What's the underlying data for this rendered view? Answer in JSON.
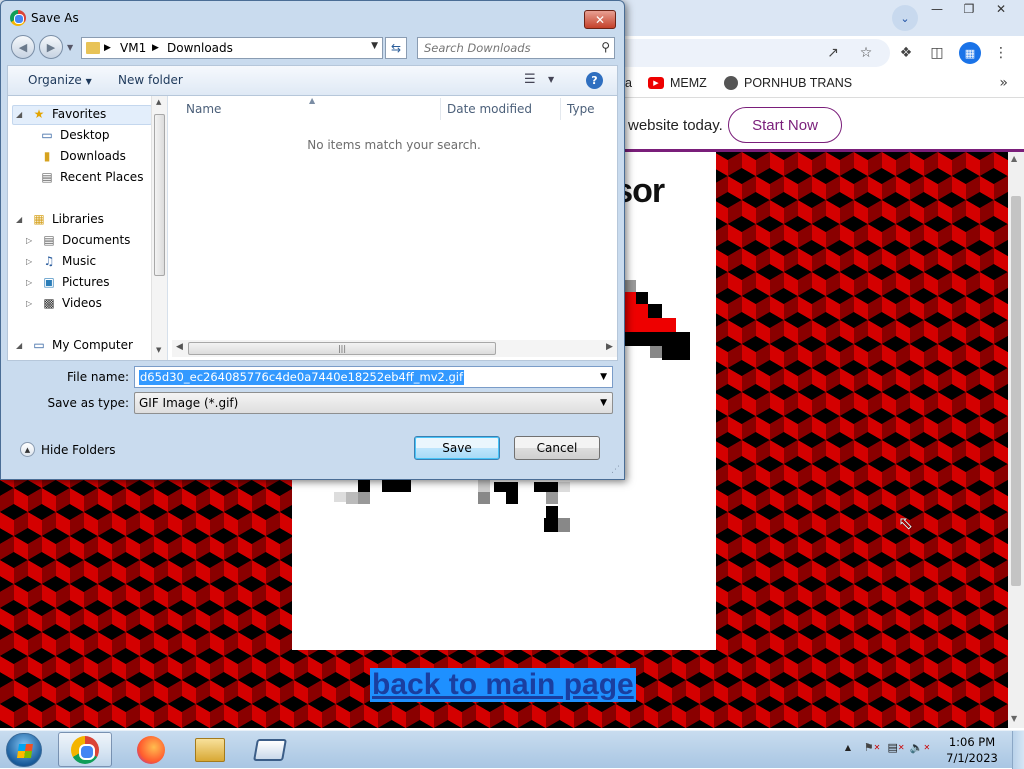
{
  "browser": {
    "bookmarks": [
      {
        "icon": "youtube-icon",
        "label": "MEMZ"
      },
      {
        "icon": "globe-icon",
        "label": "PORNHUB TRANS"
      }
    ],
    "bookmark_partial_text": "a",
    "ad": {
      "text": "website today.",
      "button": "Start Now"
    },
    "page": {
      "title_fragment": "rsor",
      "back_link": "back to main page"
    }
  },
  "dialog": {
    "title": "Save As",
    "address": [
      "VM1",
      "Downloads"
    ],
    "search_placeholder": "Search Downloads",
    "commands": {
      "organize": "Organize",
      "new_folder": "New folder"
    },
    "nav_tree": [
      {
        "label": "Favorites",
        "icon": "star-icon",
        "level": 0
      },
      {
        "label": "Desktop",
        "icon": "desktop-icon",
        "level": 1
      },
      {
        "label": "Downloads",
        "icon": "downloads-folder-icon",
        "level": 1
      },
      {
        "label": "Recent Places",
        "icon": "recent-places-icon",
        "level": 1
      },
      {
        "label": "Libraries",
        "icon": "libraries-icon",
        "level": 0
      },
      {
        "label": "Documents",
        "icon": "documents-icon",
        "level": 1
      },
      {
        "label": "Music",
        "icon": "music-icon",
        "level": 1
      },
      {
        "label": "Pictures",
        "icon": "pictures-icon",
        "level": 1
      },
      {
        "label": "Videos",
        "icon": "videos-icon",
        "level": 1
      },
      {
        "label": "My Computer",
        "icon": "computer-icon",
        "level": 0
      }
    ],
    "columns": [
      "Name",
      "Date modified",
      "Type"
    ],
    "empty_message": "No items match your search.",
    "file_name_label": "File name:",
    "file_name_value": "d65d30_ec264085776c4de0a7440e18252eb4ff_mv2.gif",
    "save_type_label": "Save as type:",
    "save_type_value": "GIF Image (*.gif)",
    "hide_folders": "Hide Folders",
    "save_button": "Save",
    "cancel_button": "Cancel"
  },
  "taskbar": {
    "apps": [
      "chrome-icon",
      "firefox-icon",
      "explorer-icon",
      "app-window-icon"
    ],
    "active_app": "chrome-icon",
    "clock_time": "1:06 PM",
    "clock_date": "7/1/2023"
  },
  "colors": {
    "ad_accent": "#7a1e7a",
    "pattern_red": "#d40000",
    "link_highlight": "#1e90ff",
    "selection_blue": "#3399ff"
  }
}
